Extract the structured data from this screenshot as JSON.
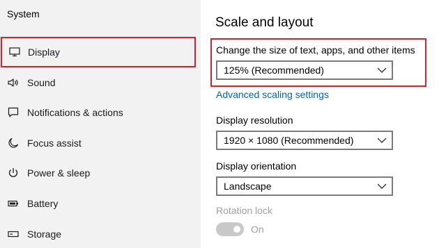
{
  "sidebar": {
    "title": "System",
    "items": [
      {
        "label": "Display",
        "icon": "monitor-icon",
        "selected": true
      },
      {
        "label": "Sound",
        "icon": "speaker-icon"
      },
      {
        "label": "Notifications & actions",
        "icon": "notification-icon"
      },
      {
        "label": "Focus assist",
        "icon": "moon-icon"
      },
      {
        "label": "Power & sleep",
        "icon": "power-icon"
      },
      {
        "label": "Battery",
        "icon": "battery-icon"
      },
      {
        "label": "Storage",
        "icon": "storage-icon"
      }
    ]
  },
  "main": {
    "section_title": "Scale and layout",
    "scale": {
      "label": "Change the size of text, apps, and other items",
      "value": "125% (Recommended)"
    },
    "advanced_link": "Advanced scaling settings",
    "resolution": {
      "label": "Display resolution",
      "value": "1920 × 1080 (Recommended)"
    },
    "orientation": {
      "label": "Display orientation",
      "value": "Landscape"
    },
    "rotation_lock": {
      "label": "Rotation lock",
      "state": "On",
      "enabled": false
    }
  },
  "colors": {
    "highlight": "#d4202f",
    "link": "#0063b1",
    "sidebar_bg": "#f2f2f2",
    "disabled_text": "#a0a0a0"
  }
}
